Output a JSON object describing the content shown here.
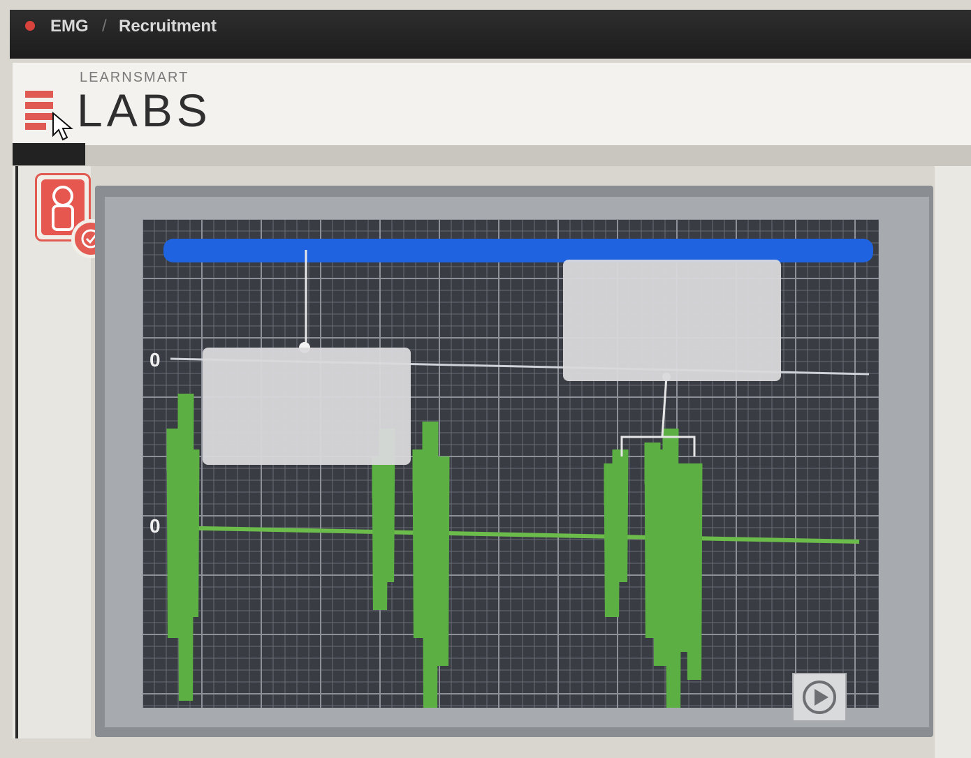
{
  "window": {
    "breadcrumb": [
      "EMG",
      "Recruitment"
    ],
    "separator": "/"
  },
  "header": {
    "brand_small": "LEARNSMART",
    "brand_big": "LABS"
  },
  "icons": {
    "menu": "menu-icon",
    "cursor": "cursor-arrow-icon",
    "app_badge": "lab-app-icon",
    "badge_check": "check-badge-icon",
    "play": "play-icon"
  },
  "colors": {
    "accent": "#e05a54",
    "blue_bar": "#1f63e0",
    "emg_trace": "#5cb043",
    "plot_bg": "#3a3c44",
    "callout": "#d9d9dc"
  },
  "plot": {
    "upper_baseline_label": "0",
    "lower_baseline_label": "0"
  }
}
